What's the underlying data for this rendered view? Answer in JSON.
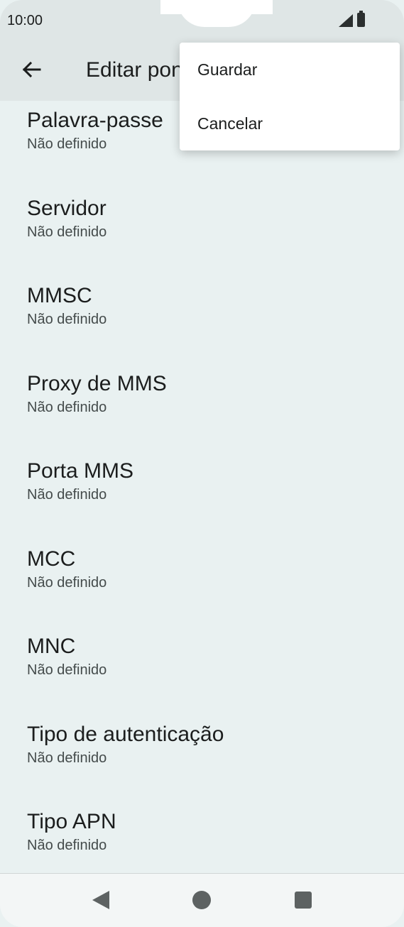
{
  "status_bar": {
    "time": "10:00"
  },
  "app_bar": {
    "title": "Editar ponto de acesso"
  },
  "menu": {
    "items": [
      "Guardar",
      "Cancelar"
    ]
  },
  "fields": [
    {
      "label": "Palavra-passe",
      "value": "Não definido"
    },
    {
      "label": "Servidor",
      "value": "Não definido"
    },
    {
      "label": "MMSC",
      "value": "Não definido"
    },
    {
      "label": "Proxy de MMS",
      "value": "Não definido"
    },
    {
      "label": "Porta MMS",
      "value": "Não definido"
    },
    {
      "label": "MCC",
      "value": "Não definido"
    },
    {
      "label": "MNC",
      "value": "Não definido"
    },
    {
      "label": "Tipo de autenticação",
      "value": "Não definido"
    },
    {
      "label": "Tipo APN",
      "value": "Não definido"
    }
  ],
  "colors": {
    "background": "#e9f1f1",
    "app_bar": "#dfe6e6",
    "menu": "#ffffff"
  }
}
